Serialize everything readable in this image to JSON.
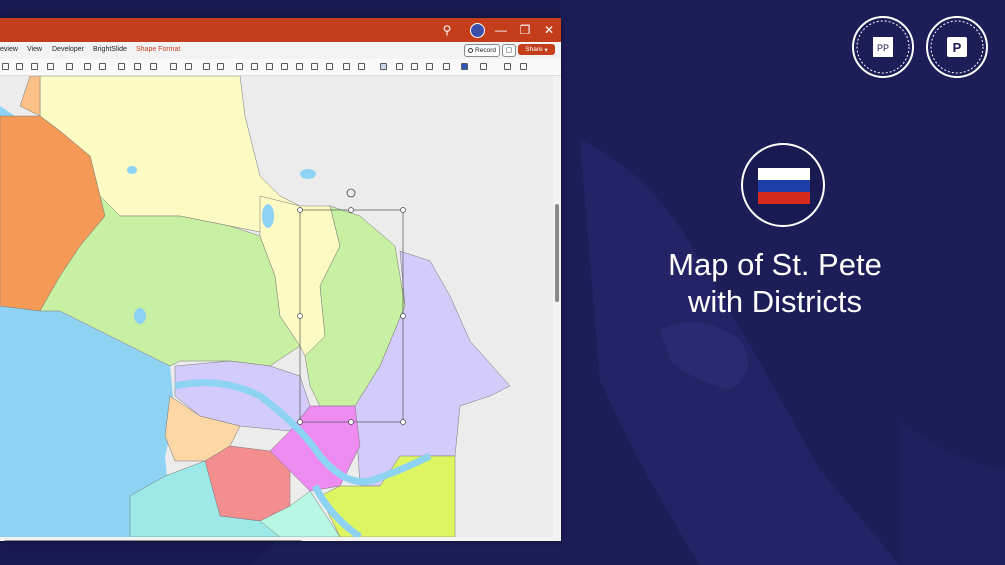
{
  "window": {
    "menu": [
      "eview",
      "View",
      "Developer",
      "BrightSlide",
      "Shape Format"
    ],
    "record_label": "Record",
    "share_label": "Share",
    "accent": "#c43e1c"
  },
  "badges": [
    {
      "name": "pptxman-badge",
      "text": "PPTXMAN · COM · PPTXMAN · COM"
    },
    {
      "name": "editable-badge",
      "text": "EDITABLE · 100 % · POWERPOINT"
    }
  ],
  "title": {
    "line1": "Map of St. Pete",
    "line2": "with Districts"
  },
  "flag": {
    "colors": [
      "#ffffff",
      "#1c3fa8",
      "#d52b1e"
    ]
  },
  "map": {
    "district_colors": [
      "#fdfbc4",
      "#c8f0a2",
      "#fbc188",
      "#f49a56",
      "#d3cbf9",
      "#fcd6a5",
      "#ee8bf0",
      "#f48e8e",
      "#ddf561",
      "#9ce9e8",
      "#b8f7e3"
    ],
    "water_color": "#8fd3f4"
  }
}
